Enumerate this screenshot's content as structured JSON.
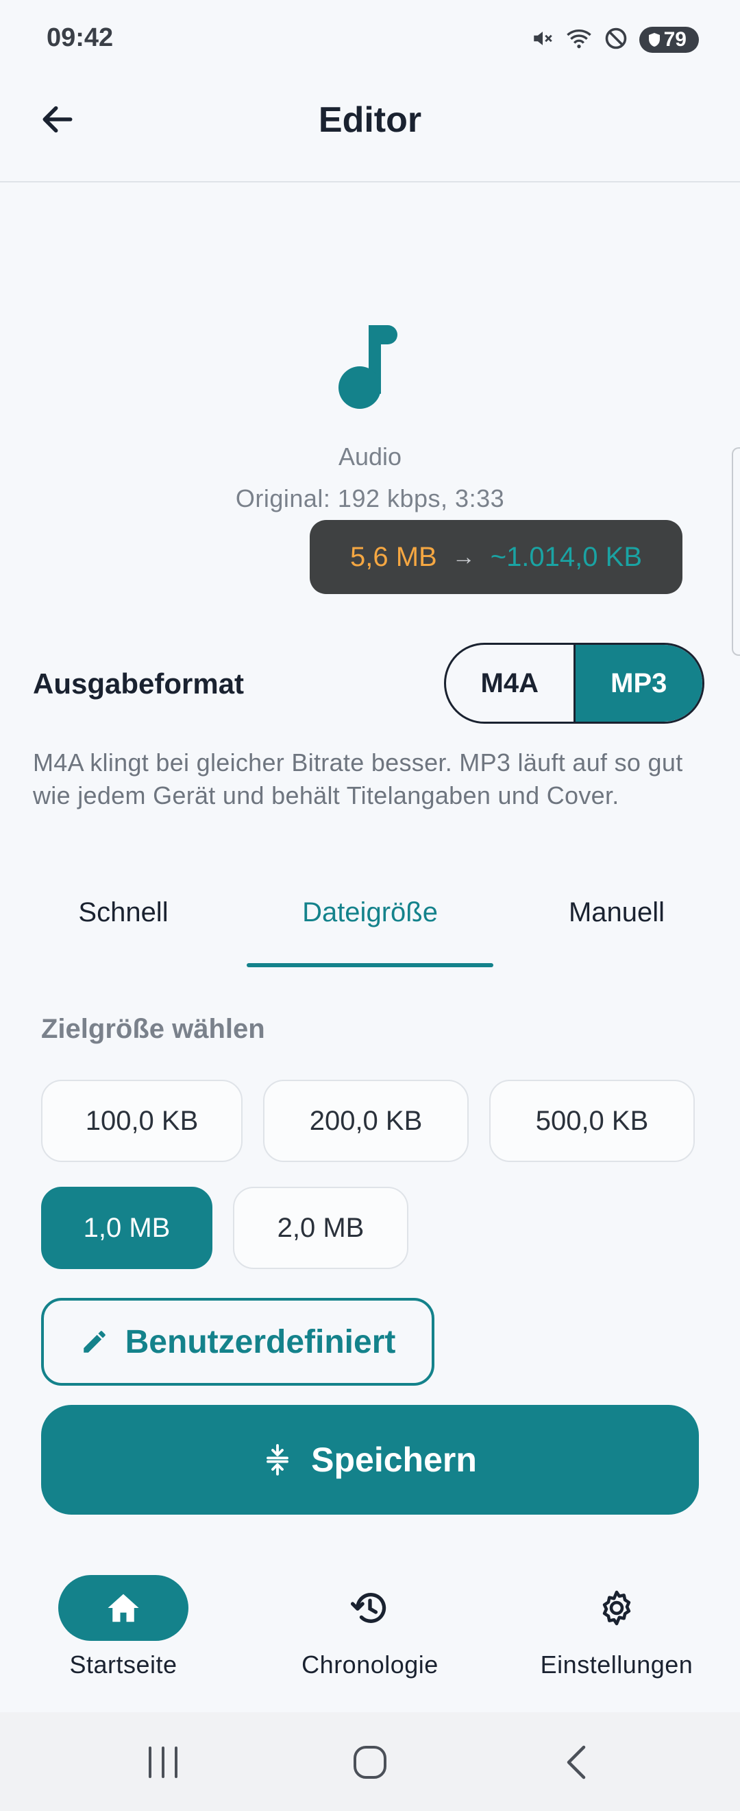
{
  "status_bar": {
    "time": "09:42",
    "battery": "79"
  },
  "app_bar": {
    "title": "Editor"
  },
  "media": {
    "type_label": "Audio",
    "original_info": "Original: 192 kbps, 3:33",
    "size_from": "5,6 MB",
    "size_arrow": "→",
    "size_to": "~1.014,0 KB"
  },
  "output_format": {
    "label": "Ausgabeformat",
    "options": [
      "M4A",
      "MP3"
    ],
    "selected": "MP3",
    "description": "M4A klingt bei gleicher Bitrate besser. MP3 läuft auf so gut wie jedem Gerät und behält Titelangaben und Cover."
  },
  "tabs": [
    {
      "label": "Schnell"
    },
    {
      "label": "Dateigröße"
    },
    {
      "label": "Manuell"
    }
  ],
  "active_tab": "Dateigröße",
  "target_size": {
    "label": "Zielgröße wählen",
    "options": [
      "100,0 KB",
      "200,0 KB",
      "500,0 KB",
      "1,0 MB",
      "2,0 MB"
    ],
    "selected": "1,0 MB",
    "custom_label": "Benutzerdefiniert"
  },
  "save_button": {
    "label": "Speichern"
  },
  "bottom_nav": [
    {
      "label": "Startseite",
      "icon": "home-icon"
    },
    {
      "label": "Chronologie",
      "icon": "history-icon"
    },
    {
      "label": "Einstellungen",
      "icon": "gear-icon"
    }
  ],
  "active_nav": "Startseite",
  "colors": {
    "accent": "#14828b",
    "size_from": "#f5a742",
    "size_to": "#1aa3a3"
  }
}
